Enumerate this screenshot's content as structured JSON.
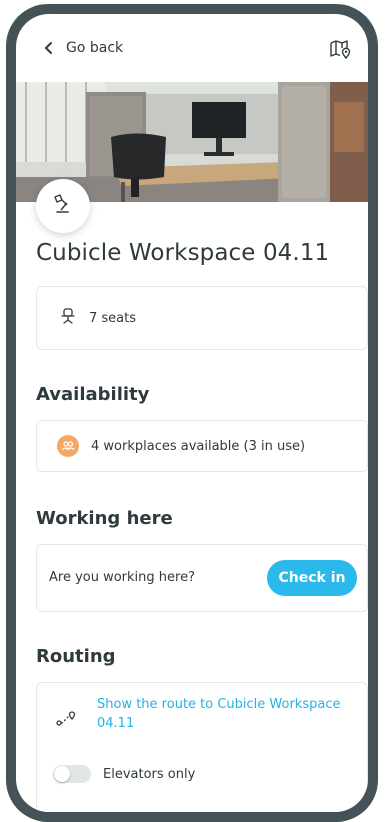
{
  "nav": {
    "back_label": "Go back"
  },
  "workspace": {
    "title": "Cubicle Workspace 04.11",
    "seats_label": "7 seats"
  },
  "availability": {
    "heading": "Availability",
    "status": "4 workplaces available (3 in use)"
  },
  "working": {
    "heading": "Working here",
    "question": "Are you working here?",
    "checkin_label": "Check in"
  },
  "routing": {
    "heading": "Routing",
    "route_link": "Show the route to Cubicle Workspace 04.11",
    "elevators_label": "Elevators only",
    "elevators_only": false
  },
  "colors": {
    "accent": "#2bb8ea",
    "link": "#25b2e6",
    "availability_badge": "#f5a766",
    "frame": "#455257"
  },
  "icons": {
    "back": "chevron-left-icon",
    "map": "map-pin-icon",
    "desk_lamp": "desk-lamp-icon",
    "seat": "chair-icon",
    "people": "people-icon",
    "route": "route-icon"
  }
}
